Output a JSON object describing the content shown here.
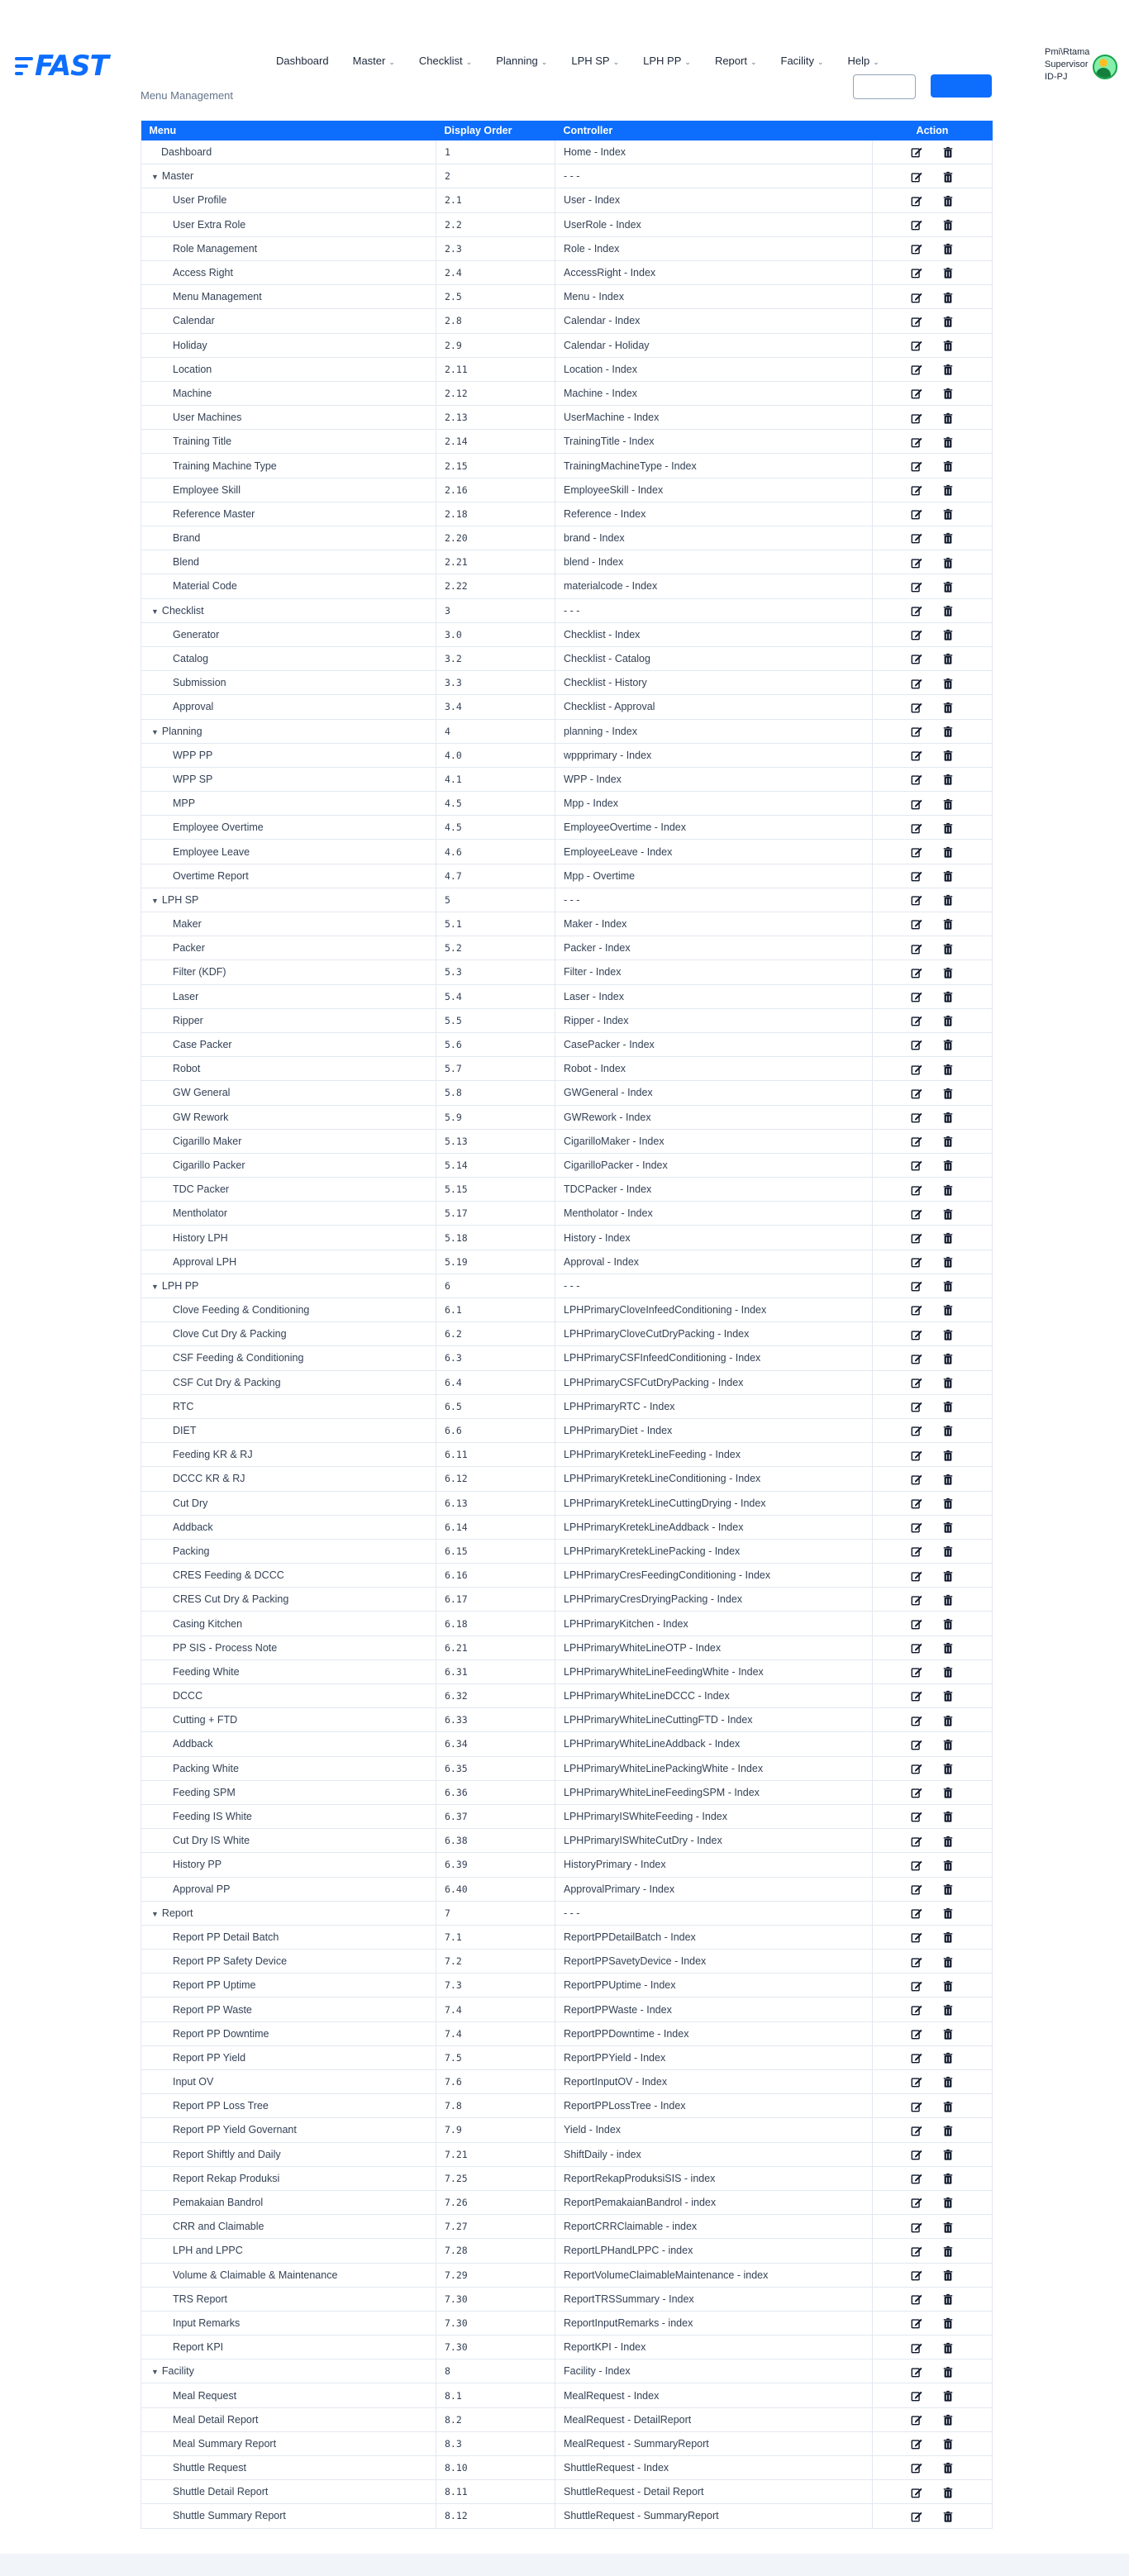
{
  "brand": {
    "logo_text": "FAST",
    "accent": "#0d6efd"
  },
  "nav": [
    {
      "label": "Dashboard",
      "dropdown": false
    },
    {
      "label": "Master",
      "dropdown": true
    },
    {
      "label": "Checklist",
      "dropdown": true
    },
    {
      "label": "Planning",
      "dropdown": true
    },
    {
      "label": "LPH SP",
      "dropdown": true
    },
    {
      "label": "LPH PP",
      "dropdown": true
    },
    {
      "label": "Report",
      "dropdown": true
    },
    {
      "label": "Facility",
      "dropdown": true
    },
    {
      "label": "Help",
      "dropdown": true
    }
  ],
  "user": {
    "name": "Pmi\\Rtama",
    "role": "Supervisor",
    "plant": "ID-PJ"
  },
  "page": {
    "subtitle": "Menu Management"
  },
  "table": {
    "headers": {
      "menu": "Menu",
      "order": "Display Order",
      "controller": "Controller",
      "action": "Action"
    },
    "rows": [
      {
        "menu": "Dashboard",
        "order": "1",
        "controller": "Home - Index",
        "level": 0,
        "group": false
      },
      {
        "menu": "Master",
        "order": "2",
        "controller": "- - -",
        "level": 0,
        "group": true
      },
      {
        "menu": "User Profile",
        "order": "2.1",
        "controller": "User - Index",
        "level": 1,
        "group": false
      },
      {
        "menu": "User Extra Role",
        "order": "2.2",
        "controller": "UserRole - Index",
        "level": 1,
        "group": false
      },
      {
        "menu": "Role Management",
        "order": "2.3",
        "controller": "Role - Index",
        "level": 1,
        "group": false
      },
      {
        "menu": "Access Right",
        "order": "2.4",
        "controller": "AccessRight - Index",
        "level": 1,
        "group": false
      },
      {
        "menu": "Menu Management",
        "order": "2.5",
        "controller": "Menu - Index",
        "level": 1,
        "group": false
      },
      {
        "menu": "Calendar",
        "order": "2.8",
        "controller": "Calendar - Index",
        "level": 1,
        "group": false
      },
      {
        "menu": "Holiday",
        "order": "2.9",
        "controller": "Calendar - Holiday",
        "level": 1,
        "group": false
      },
      {
        "menu": "Location",
        "order": "2.11",
        "controller": "Location - Index",
        "level": 1,
        "group": false
      },
      {
        "menu": "Machine",
        "order": "2.12",
        "controller": "Machine - Index",
        "level": 1,
        "group": false
      },
      {
        "menu": "User Machines",
        "order": "2.13",
        "controller": "UserMachine - Index",
        "level": 1,
        "group": false
      },
      {
        "menu": "Training Title",
        "order": "2.14",
        "controller": "TrainingTitle - Index",
        "level": 1,
        "group": false
      },
      {
        "menu": "Training Machine Type",
        "order": "2.15",
        "controller": "TrainingMachineType - Index",
        "level": 1,
        "group": false
      },
      {
        "menu": "Employee Skill",
        "order": "2.16",
        "controller": "EmployeeSkill - Index",
        "level": 1,
        "group": false
      },
      {
        "menu": "Reference Master",
        "order": "2.18",
        "controller": "Reference - Index",
        "level": 1,
        "group": false
      },
      {
        "menu": "Brand",
        "order": "2.20",
        "controller": "brand - Index",
        "level": 1,
        "group": false
      },
      {
        "menu": "Blend",
        "order": "2.21",
        "controller": "blend - Index",
        "level": 1,
        "group": false
      },
      {
        "menu": "Material Code",
        "order": "2.22",
        "controller": "materialcode - Index",
        "level": 1,
        "group": false
      },
      {
        "menu": "Checklist",
        "order": "3",
        "controller": "- - -",
        "level": 0,
        "group": true
      },
      {
        "menu": "Generator",
        "order": "3.0",
        "controller": "Checklist - Index",
        "level": 1,
        "group": false
      },
      {
        "menu": "Catalog",
        "order": "3.2",
        "controller": "Checklist - Catalog",
        "level": 1,
        "group": false
      },
      {
        "menu": "Submission",
        "order": "3.3",
        "controller": "Checklist - History",
        "level": 1,
        "group": false
      },
      {
        "menu": "Approval",
        "order": "3.4",
        "controller": "Checklist - Approval",
        "level": 1,
        "group": false
      },
      {
        "menu": "Planning",
        "order": "4",
        "controller": "planning - Index",
        "level": 0,
        "group": true
      },
      {
        "menu": "WPP PP",
        "order": "4.0",
        "controller": "wppprimary - Index",
        "level": 1,
        "group": false
      },
      {
        "menu": "WPP SP",
        "order": "4.1",
        "controller": "WPP - Index",
        "level": 1,
        "group": false
      },
      {
        "menu": "MPP",
        "order": "4.5",
        "controller": "Mpp - Index",
        "level": 1,
        "group": false
      },
      {
        "menu": "Employee Overtime",
        "order": "4.5",
        "controller": "EmployeeOvertime - Index",
        "level": 1,
        "group": false
      },
      {
        "menu": "Employee Leave",
        "order": "4.6",
        "controller": "EmployeeLeave - Index",
        "level": 1,
        "group": false
      },
      {
        "menu": "Overtime Report",
        "order": "4.7",
        "controller": "Mpp - Overtime",
        "level": 1,
        "group": false
      },
      {
        "menu": "LPH SP",
        "order": "5",
        "controller": "- - -",
        "level": 0,
        "group": true
      },
      {
        "menu": "Maker",
        "order": "5.1",
        "controller": "Maker - Index",
        "level": 1,
        "group": false
      },
      {
        "menu": "Packer",
        "order": "5.2",
        "controller": "Packer - Index",
        "level": 1,
        "group": false
      },
      {
        "menu": "Filter (KDF)",
        "order": "5.3",
        "controller": "Filter - Index",
        "level": 1,
        "group": false
      },
      {
        "menu": "Laser",
        "order": "5.4",
        "controller": "Laser - Index",
        "level": 1,
        "group": false
      },
      {
        "menu": "Ripper",
        "order": "5.5",
        "controller": "Ripper - Index",
        "level": 1,
        "group": false
      },
      {
        "menu": "Case Packer",
        "order": "5.6",
        "controller": "CasePacker - Index",
        "level": 1,
        "group": false
      },
      {
        "menu": "Robot",
        "order": "5.7",
        "controller": "Robot - Index",
        "level": 1,
        "group": false
      },
      {
        "menu": "GW General",
        "order": "5.8",
        "controller": "GWGeneral - Index",
        "level": 1,
        "group": false
      },
      {
        "menu": "GW Rework",
        "order": "5.9",
        "controller": "GWRework - Index",
        "level": 1,
        "group": false
      },
      {
        "menu": "Cigarillo Maker",
        "order": "5.13",
        "controller": "CigarilloMaker - Index",
        "level": 1,
        "group": false
      },
      {
        "menu": "Cigarillo Packer",
        "order": "5.14",
        "controller": "CigarilloPacker - Index",
        "level": 1,
        "group": false
      },
      {
        "menu": "TDC Packer",
        "order": "5.15",
        "controller": "TDCPacker - Index",
        "level": 1,
        "group": false
      },
      {
        "menu": "Mentholator",
        "order": "5.17",
        "controller": "Mentholator - Index",
        "level": 1,
        "group": false
      },
      {
        "menu": "History LPH",
        "order": "5.18",
        "controller": "History - Index",
        "level": 1,
        "group": false
      },
      {
        "menu": "Approval LPH",
        "order": "5.19",
        "controller": "Approval - Index",
        "level": 1,
        "group": false
      },
      {
        "menu": "LPH PP",
        "order": "6",
        "controller": "- - -",
        "level": 0,
        "group": true
      },
      {
        "menu": "Clove Feeding & Conditioning",
        "order": "6.1",
        "controller": "LPHPrimaryCloveInfeedConditioning - Index",
        "level": 1,
        "group": false
      },
      {
        "menu": "Clove Cut Dry & Packing",
        "order": "6.2",
        "controller": "LPHPrimaryCloveCutDryPacking - Index",
        "level": 1,
        "group": false
      },
      {
        "menu": "CSF Feeding & Conditioning",
        "order": "6.3",
        "controller": "LPHPrimaryCSFInfeedConditioning - Index",
        "level": 1,
        "group": false
      },
      {
        "menu": "CSF Cut Dry & Packing",
        "order": "6.4",
        "controller": "LPHPrimaryCSFCutDryPacking - Index",
        "level": 1,
        "group": false
      },
      {
        "menu": "RTC",
        "order": "6.5",
        "controller": "LPHPrimaryRTC - Index",
        "level": 1,
        "group": false
      },
      {
        "menu": "DIET",
        "order": "6.6",
        "controller": "LPHPrimaryDiet - Index",
        "level": 1,
        "group": false
      },
      {
        "menu": "Feeding KR & RJ",
        "order": "6.11",
        "controller": "LPHPrimaryKretekLineFeeding - Index",
        "level": 1,
        "group": false
      },
      {
        "menu": "DCCC KR & RJ",
        "order": "6.12",
        "controller": "LPHPrimaryKretekLineConditioning - Index",
        "level": 1,
        "group": false
      },
      {
        "menu": "Cut Dry",
        "order": "6.13",
        "controller": "LPHPrimaryKretekLineCuttingDrying - Index",
        "level": 1,
        "group": false
      },
      {
        "menu": "Addback",
        "order": "6.14",
        "controller": "LPHPrimaryKretekLineAddback - Index",
        "level": 1,
        "group": false
      },
      {
        "menu": "Packing",
        "order": "6.15",
        "controller": "LPHPrimaryKretekLinePacking - Index",
        "level": 1,
        "group": false
      },
      {
        "menu": "CRES Feeding & DCCC",
        "order": "6.16",
        "controller": "LPHPrimaryCresFeedingConditioning - Index",
        "level": 1,
        "group": false
      },
      {
        "menu": "CRES Cut Dry & Packing",
        "order": "6.17",
        "controller": "LPHPrimaryCresDryingPacking - Index",
        "level": 1,
        "group": false
      },
      {
        "menu": "Casing Kitchen",
        "order": "6.18",
        "controller": "LPHPrimaryKitchen - Index",
        "level": 1,
        "group": false
      },
      {
        "menu": "PP SIS - Process Note",
        "order": "6.21",
        "controller": "LPHPrimaryWhiteLineOTP - Index",
        "level": 1,
        "group": false
      },
      {
        "menu": "Feeding White",
        "order": "6.31",
        "controller": "LPHPrimaryWhiteLineFeedingWhite - Index",
        "level": 1,
        "group": false
      },
      {
        "menu": "DCCC",
        "order": "6.32",
        "controller": "LPHPrimaryWhiteLineDCCC - Index",
        "level": 1,
        "group": false
      },
      {
        "menu": "Cutting + FTD",
        "order": "6.33",
        "controller": "LPHPrimaryWhiteLineCuttingFTD - Index",
        "level": 1,
        "group": false
      },
      {
        "menu": "Addback",
        "order": "6.34",
        "controller": "LPHPrimaryWhiteLineAddback - Index",
        "level": 1,
        "group": false
      },
      {
        "menu": "Packing White",
        "order": "6.35",
        "controller": "LPHPrimaryWhiteLinePackingWhite - Index",
        "level": 1,
        "group": false
      },
      {
        "menu": "Feeding SPM",
        "order": "6.36",
        "controller": "LPHPrimaryWhiteLineFeedingSPM - Index",
        "level": 1,
        "group": false
      },
      {
        "menu": "Feeding IS White",
        "order": "6.37",
        "controller": "LPHPrimaryISWhiteFeeding - Index",
        "level": 1,
        "group": false
      },
      {
        "menu": "Cut Dry IS White",
        "order": "6.38",
        "controller": "LPHPrimaryISWhiteCutDry - Index",
        "level": 1,
        "group": false
      },
      {
        "menu": "History PP",
        "order": "6.39",
        "controller": "HistoryPrimary - Index",
        "level": 1,
        "group": false
      },
      {
        "menu": "Approval PP",
        "order": "6.40",
        "controller": "ApprovalPrimary - Index",
        "level": 1,
        "group": false
      },
      {
        "menu": "Report",
        "order": "7",
        "controller": "- - -",
        "level": 0,
        "group": true
      },
      {
        "menu": "Report PP Detail Batch",
        "order": "7.1",
        "controller": "ReportPPDetailBatch - Index",
        "level": 1,
        "group": false
      },
      {
        "menu": "Report PP Safety Device",
        "order": "7.2",
        "controller": "ReportPPSavetyDevice - Index",
        "level": 1,
        "group": false
      },
      {
        "menu": "Report PP Uptime",
        "order": "7.3",
        "controller": "ReportPPUptime - Index",
        "level": 1,
        "group": false
      },
      {
        "menu": "Report PP Waste",
        "order": "7.4",
        "controller": "ReportPPWaste - Index",
        "level": 1,
        "group": false
      },
      {
        "menu": "Report PP Downtime",
        "order": "7.4",
        "controller": "ReportPPDowntime - Index",
        "level": 1,
        "group": false
      },
      {
        "menu": "Report PP Yield",
        "order": "7.5",
        "controller": "ReportPPYield - Index",
        "level": 1,
        "group": false
      },
      {
        "menu": "Input OV",
        "order": "7.6",
        "controller": "ReportInputOV - Index",
        "level": 1,
        "group": false
      },
      {
        "menu": "Report PP Loss Tree",
        "order": "7.8",
        "controller": "ReportPPLossTree - Index",
        "level": 1,
        "group": false
      },
      {
        "menu": "Report PP Yield Governant",
        "order": "7.9",
        "controller": "Yield - Index",
        "level": 1,
        "group": false
      },
      {
        "menu": "Report Shiftly and Daily",
        "order": "7.21",
        "controller": "ShiftDaily - index",
        "level": 1,
        "group": false
      },
      {
        "menu": "Report Rekap Produksi",
        "order": "7.25",
        "controller": "ReportRekapProduksiSIS - index",
        "level": 1,
        "group": false
      },
      {
        "menu": "Pemakaian Bandrol",
        "order": "7.26",
        "controller": "ReportPemakaianBandrol - index",
        "level": 1,
        "group": false
      },
      {
        "menu": "CRR and Claimable",
        "order": "7.27",
        "controller": "ReportCRRClaimable - index",
        "level": 1,
        "group": false
      },
      {
        "menu": "LPH and LPPC",
        "order": "7.28",
        "controller": "ReportLPHandLPPC - index",
        "level": 1,
        "group": false
      },
      {
        "menu": "Volume & Claimable & Maintenance",
        "order": "7.29",
        "controller": "ReportVolumeClaimableMaintenance - index",
        "level": 1,
        "group": false
      },
      {
        "menu": "TRS Report",
        "order": "7.30",
        "controller": "ReportTRSSummary - Index",
        "level": 1,
        "group": false
      },
      {
        "menu": "Input Remarks",
        "order": "7.30",
        "controller": "ReportInputRemarks - index",
        "level": 1,
        "group": false
      },
      {
        "menu": "Report KPI",
        "order": "7.30",
        "controller": "ReportKPI - Index",
        "level": 1,
        "group": false
      },
      {
        "menu": "Facility",
        "order": "8",
        "controller": "Facility - Index",
        "level": 0,
        "group": true
      },
      {
        "menu": "Meal Request",
        "order": "8.1",
        "controller": "MealRequest - Index",
        "level": 1,
        "group": false
      },
      {
        "menu": "Meal Detail Report",
        "order": "8.2",
        "controller": "MealRequest - DetailReport",
        "level": 1,
        "group": false
      },
      {
        "menu": "Meal Summary Report",
        "order": "8.3",
        "controller": "MealRequest - SummaryReport",
        "level": 1,
        "group": false
      },
      {
        "menu": "Shuttle Request",
        "order": "8.10",
        "controller": "ShuttleRequest - Index",
        "level": 1,
        "group": false
      },
      {
        "menu": "Shuttle Detail Report",
        "order": "8.11",
        "controller": "ShuttleRequest - Detail Report",
        "level": 1,
        "group": false
      },
      {
        "menu": "Shuttle Summary Report",
        "order": "8.12",
        "controller": "ShuttleRequest - SummaryReport",
        "level": 1,
        "group": false
      }
    ]
  },
  "icons": {
    "edit": "edit-icon",
    "delete": "trash-icon",
    "group_toggle": "caret-down-icon"
  }
}
